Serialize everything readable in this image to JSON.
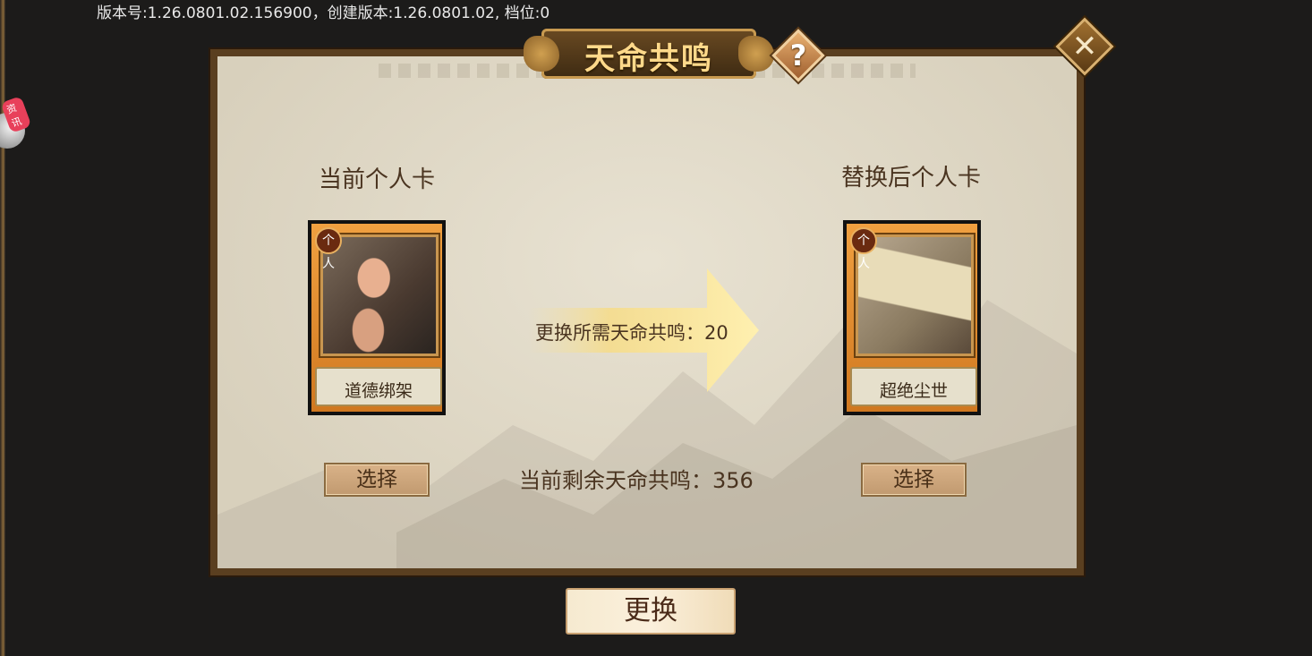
{
  "version_text": "版本号:1.26.0801.02.156900，创建版本:1.26.0801.02, 档位:0",
  "news_badge": "资讯",
  "dialog": {
    "title": "天命共鸣",
    "help_icon": "question-icon",
    "close_icon": "close-icon"
  },
  "current": {
    "heading": "当前个人卡",
    "card_tag": "个人",
    "card_name": "道德绑架",
    "select_label": "选择"
  },
  "replacement": {
    "heading": "替换后个人卡",
    "card_tag": "个人",
    "card_name": "超绝尘世",
    "select_label": "选择"
  },
  "cost_text": "更换所需天命共鸣：20",
  "remaining_text": "当前剩余天命共鸣：356",
  "confirm_label": "更换",
  "colors": {
    "frame": "#5a3f20",
    "paper": "#e2dccb",
    "card_border": "#e08a30",
    "title_text": "#ffd98a"
  }
}
